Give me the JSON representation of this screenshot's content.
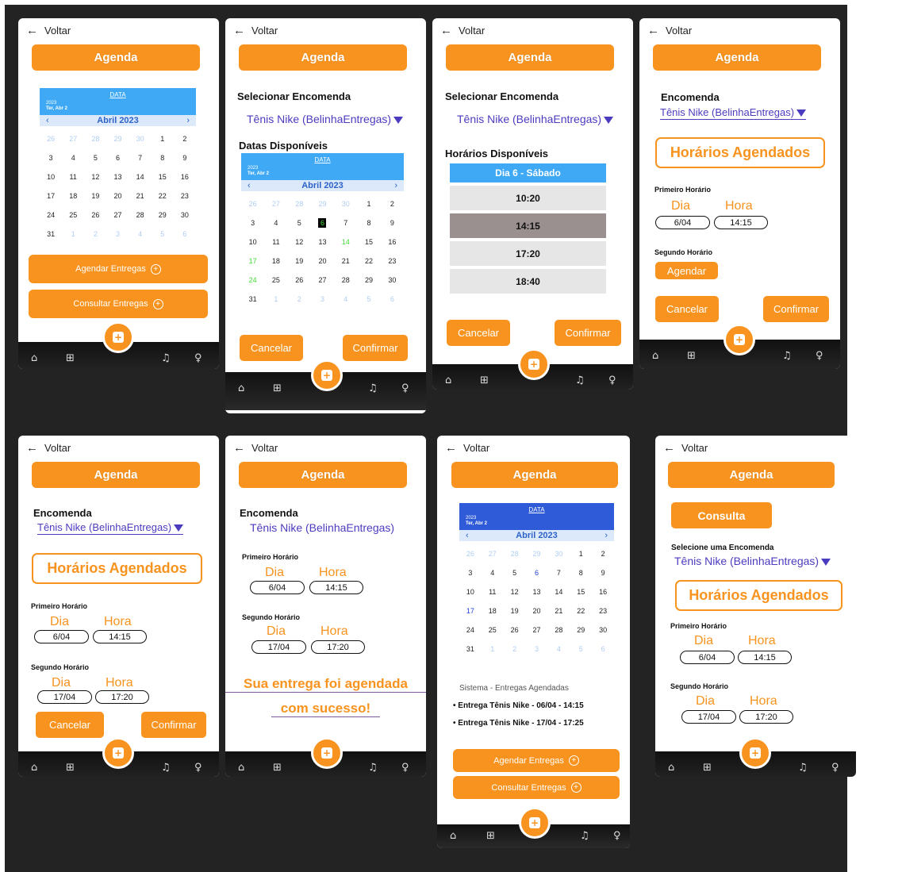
{
  "common": {
    "back": "Voltar",
    "agenda": "Agenda",
    "cancel": "Cancelar",
    "confirm": "Confirmar",
    "accent": "#f7931e",
    "link_color": "#4b3bbf"
  },
  "calendar": {
    "title": "DATA",
    "year": "2023",
    "date": "Ter, Abr 2",
    "month": "Abril 2023",
    "prev": "‹",
    "next": "›"
  },
  "buttons": {
    "agendar": "Agendar Entregas",
    "consultar": "Consultar Entregas",
    "agendar_small": "Agendar"
  },
  "order": {
    "select_title": "Selecionar Encomenda",
    "title": "Encomenda",
    "value": "Tênis Nike (BelinhaEntregas)",
    "select_one": "Selecione uma Encomenda"
  },
  "available_dates": "Datas Disponíveis",
  "available_times": "Horários Disponíveis",
  "day_header": "Dia 6 - Sábado",
  "slots": [
    "10:20",
    "14:15",
    "17:20",
    "18:40"
  ],
  "scheduled": "Horários Agendados",
  "first": "Primeiro Horário",
  "second": "Segundo Horário",
  "dia": "Dia",
  "hora": "Hora",
  "first_day": "6/04",
  "first_time": "14:15",
  "second_day": "17/04",
  "second_time": "17:20",
  "success_line1": "Sua entrega foi agendada",
  "success_line2": "com sucesso!",
  "consulta": "Consulta",
  "system": {
    "title": "Sistema - Entregas Agendadas",
    "items": [
      "Entrega Tênis Nike - 06/04 - 14:15",
      "Entrega Tênis Nike - 17/04 - 17:25"
    ]
  }
}
